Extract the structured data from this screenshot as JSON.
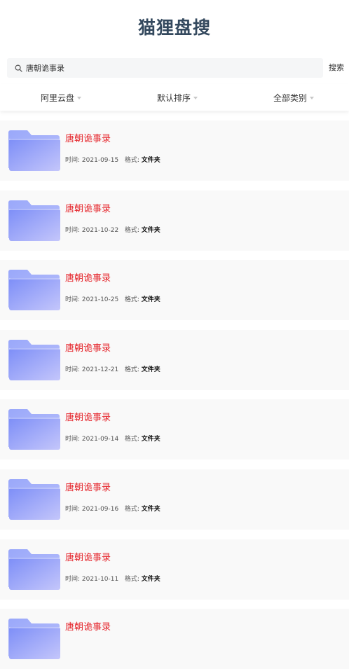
{
  "app": {
    "title": "猫狸盘搜"
  },
  "search": {
    "value": "唐朝诡事录",
    "button_label": "搜索"
  },
  "filters": [
    {
      "label": "阿里云盘"
    },
    {
      "label": "默认排序"
    },
    {
      "label": "全部类别"
    }
  ],
  "result_labels": {
    "time": "时间:",
    "format": "格式:"
  },
  "results": [
    {
      "title": "唐朝诡事录",
      "date": "2021-09-15",
      "format": "文件夹"
    },
    {
      "title": "唐朝诡事录",
      "date": "2021-10-22",
      "format": "文件夹"
    },
    {
      "title": "唐朝诡事录",
      "date": "2021-10-25",
      "format": "文件夹"
    },
    {
      "title": "唐朝诡事录",
      "date": "2021-12-21",
      "format": "文件夹"
    },
    {
      "title": "唐朝诡事录",
      "date": "2021-09-14",
      "format": "文件夹"
    },
    {
      "title": "唐朝诡事录",
      "date": "2021-09-16",
      "format": "文件夹"
    },
    {
      "title": "唐朝诡事录",
      "date": "2021-10-11",
      "format": "文件夹"
    },
    {
      "title": "唐朝诡事录",
      "date": "",
      "format": ""
    }
  ],
  "colors": {
    "title": "#34495e",
    "result_title": "#e5252b",
    "folder_front": "#8d9cf8",
    "folder_back": "#a9b4fb"
  },
  "icons": {
    "search": "search-icon",
    "folder": "folder-icon",
    "caret": "caret-down-icon"
  }
}
